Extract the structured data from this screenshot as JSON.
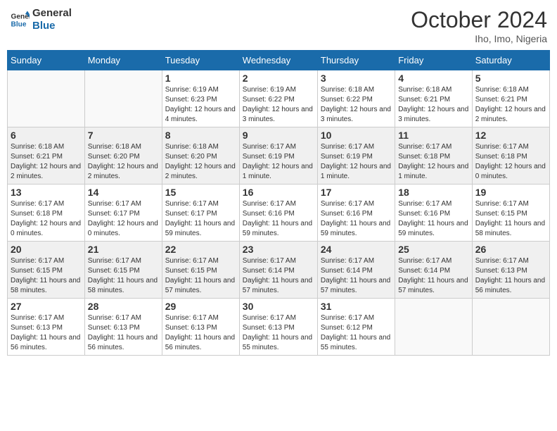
{
  "logo": {
    "line1": "General",
    "line2": "Blue"
  },
  "title": "October 2024",
  "subtitle": "Iho, Imo, Nigeria",
  "days_of_week": [
    "Sunday",
    "Monday",
    "Tuesday",
    "Wednesday",
    "Thursday",
    "Friday",
    "Saturday"
  ],
  "weeks": [
    [
      {
        "day": "",
        "info": ""
      },
      {
        "day": "",
        "info": ""
      },
      {
        "day": "1",
        "info": "Sunrise: 6:19 AM\nSunset: 6:23 PM\nDaylight: 12 hours and 4 minutes."
      },
      {
        "day": "2",
        "info": "Sunrise: 6:19 AM\nSunset: 6:22 PM\nDaylight: 12 hours and 3 minutes."
      },
      {
        "day": "3",
        "info": "Sunrise: 6:18 AM\nSunset: 6:22 PM\nDaylight: 12 hours and 3 minutes."
      },
      {
        "day": "4",
        "info": "Sunrise: 6:18 AM\nSunset: 6:21 PM\nDaylight: 12 hours and 3 minutes."
      },
      {
        "day": "5",
        "info": "Sunrise: 6:18 AM\nSunset: 6:21 PM\nDaylight: 12 hours and 2 minutes."
      }
    ],
    [
      {
        "day": "6",
        "info": "Sunrise: 6:18 AM\nSunset: 6:21 PM\nDaylight: 12 hours and 2 minutes."
      },
      {
        "day": "7",
        "info": "Sunrise: 6:18 AM\nSunset: 6:20 PM\nDaylight: 12 hours and 2 minutes."
      },
      {
        "day": "8",
        "info": "Sunrise: 6:18 AM\nSunset: 6:20 PM\nDaylight: 12 hours and 2 minutes."
      },
      {
        "day": "9",
        "info": "Sunrise: 6:17 AM\nSunset: 6:19 PM\nDaylight: 12 hours and 1 minute."
      },
      {
        "day": "10",
        "info": "Sunrise: 6:17 AM\nSunset: 6:19 PM\nDaylight: 12 hours and 1 minute."
      },
      {
        "day": "11",
        "info": "Sunrise: 6:17 AM\nSunset: 6:18 PM\nDaylight: 12 hours and 1 minute."
      },
      {
        "day": "12",
        "info": "Sunrise: 6:17 AM\nSunset: 6:18 PM\nDaylight: 12 hours and 0 minutes."
      }
    ],
    [
      {
        "day": "13",
        "info": "Sunrise: 6:17 AM\nSunset: 6:18 PM\nDaylight: 12 hours and 0 minutes."
      },
      {
        "day": "14",
        "info": "Sunrise: 6:17 AM\nSunset: 6:17 PM\nDaylight: 12 hours and 0 minutes."
      },
      {
        "day": "15",
        "info": "Sunrise: 6:17 AM\nSunset: 6:17 PM\nDaylight: 11 hours and 59 minutes."
      },
      {
        "day": "16",
        "info": "Sunrise: 6:17 AM\nSunset: 6:16 PM\nDaylight: 11 hours and 59 minutes."
      },
      {
        "day": "17",
        "info": "Sunrise: 6:17 AM\nSunset: 6:16 PM\nDaylight: 11 hours and 59 minutes."
      },
      {
        "day": "18",
        "info": "Sunrise: 6:17 AM\nSunset: 6:16 PM\nDaylight: 11 hours and 59 minutes."
      },
      {
        "day": "19",
        "info": "Sunrise: 6:17 AM\nSunset: 6:15 PM\nDaylight: 11 hours and 58 minutes."
      }
    ],
    [
      {
        "day": "20",
        "info": "Sunrise: 6:17 AM\nSunset: 6:15 PM\nDaylight: 11 hours and 58 minutes."
      },
      {
        "day": "21",
        "info": "Sunrise: 6:17 AM\nSunset: 6:15 PM\nDaylight: 11 hours and 58 minutes."
      },
      {
        "day": "22",
        "info": "Sunrise: 6:17 AM\nSunset: 6:15 PM\nDaylight: 11 hours and 57 minutes."
      },
      {
        "day": "23",
        "info": "Sunrise: 6:17 AM\nSunset: 6:14 PM\nDaylight: 11 hours and 57 minutes."
      },
      {
        "day": "24",
        "info": "Sunrise: 6:17 AM\nSunset: 6:14 PM\nDaylight: 11 hours and 57 minutes."
      },
      {
        "day": "25",
        "info": "Sunrise: 6:17 AM\nSunset: 6:14 PM\nDaylight: 11 hours and 57 minutes."
      },
      {
        "day": "26",
        "info": "Sunrise: 6:17 AM\nSunset: 6:13 PM\nDaylight: 11 hours and 56 minutes."
      }
    ],
    [
      {
        "day": "27",
        "info": "Sunrise: 6:17 AM\nSunset: 6:13 PM\nDaylight: 11 hours and 56 minutes."
      },
      {
        "day": "28",
        "info": "Sunrise: 6:17 AM\nSunset: 6:13 PM\nDaylight: 11 hours and 56 minutes."
      },
      {
        "day": "29",
        "info": "Sunrise: 6:17 AM\nSunset: 6:13 PM\nDaylight: 11 hours and 56 minutes."
      },
      {
        "day": "30",
        "info": "Sunrise: 6:17 AM\nSunset: 6:13 PM\nDaylight: 11 hours and 55 minutes."
      },
      {
        "day": "31",
        "info": "Sunrise: 6:17 AM\nSunset: 6:12 PM\nDaylight: 11 hours and 55 minutes."
      },
      {
        "day": "",
        "info": ""
      },
      {
        "day": "",
        "info": ""
      }
    ]
  ]
}
